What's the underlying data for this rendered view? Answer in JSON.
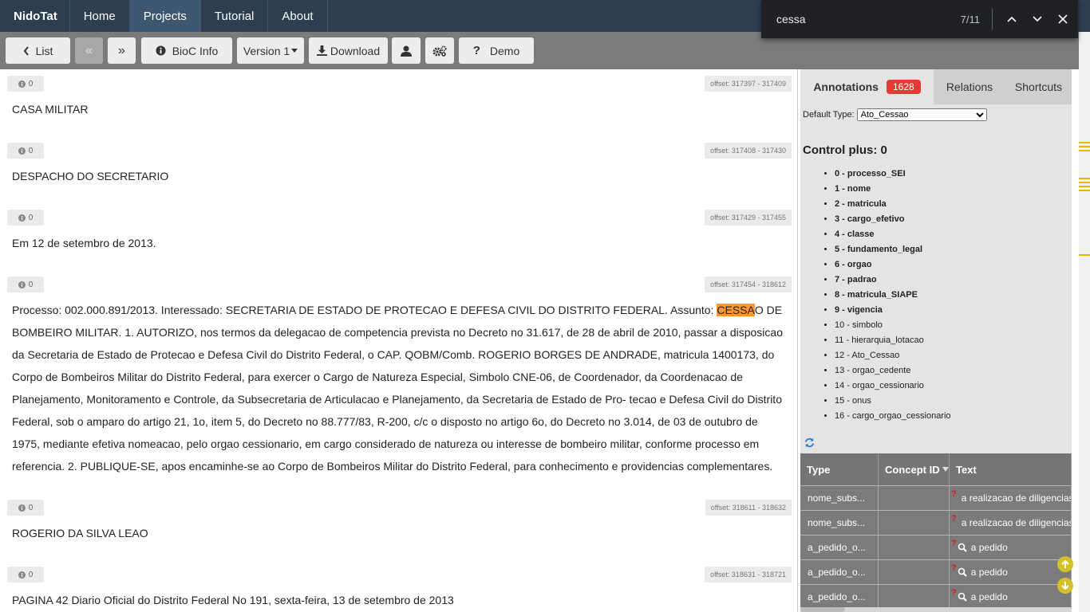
{
  "navbar": {
    "brand": "NidoTat",
    "links": [
      "Home",
      "Projects",
      "Tutorial",
      "About"
    ],
    "active": "Projects"
  },
  "findbar": {
    "query": "cessa",
    "count": "7/11"
  },
  "toolbar": {
    "list": "List",
    "bioc_info": "BioC Info",
    "version": "Version 1",
    "download": "Download",
    "demo": "Demo"
  },
  "passages": [
    {
      "count": "0",
      "offset": "offset: 317397 - 317409",
      "text": "CASA MILITAR"
    },
    {
      "count": "0",
      "offset": "offset: 317408 - 317430",
      "text": "DESPACHO DO SECRETARIO"
    },
    {
      "count": "0",
      "offset": "offset: 317429 - 317455",
      "text": "Em 12 de setembro de 2013."
    },
    {
      "count": "0",
      "offset": "offset: 317454 - 318612",
      "text_before": "Processo: 002.000.891/2013. Interessado: SECRETARIA DE ESTADO DE PROTECAO E DEFESA CIVIL DO DISTRITO FEDERAL. Assunto: ",
      "highlight": "CESSA",
      "text_after": "O DE BOMBEIRO MILITAR. 1. AUTORIZO, nos termos da delegacao de competencia prevista no Decreto no 31.617, de 28 de abril de 2010, passar a disposicao da Secretaria de Estado de Protecao e Defesa Civil do Distrito Federal, o CAP. QOBM/Comb. ROGERIO BORGES DE ANDRADE, matricula 1400173, do Corpo de Bombeiros Militar do Distrito Federal, para exercer o Cargo de Natureza Especial, Simbolo CNE-06, de Coordenador, da Coordenacao de Planejamento, Monitoramento e Controle, da Subsecretaria de Articulacao e Planejamento, da Secretaria de Estado de Pro- tecao e Defesa Civil do Distrito Federal, sob o amparo do artigo 21, 1o, item 5, do Decreto no 88.777/83, R-200, c/c o disposto no artigo 6o, do Decreto no 3.014, de 03 de outubro de 1975, mediante efetiva nomeacao, pelo orgao cessionario, em cargo considerado de natureza ou interesse de bombeiro militar, conforme processo em referencia. 2. PUBLIQUE-SE, apos encaminhe-se ao Corpo de Bombeiros Militar do Distrito Federal, para conhecimento e providencias complementares."
    },
    {
      "count": "0",
      "offset": "offset: 318611 - 318632",
      "text": "ROGERIO DA SILVA LEAO"
    },
    {
      "count": "0",
      "offset": "offset: 318631 - 318721",
      "text": "PAGINA 42 Diario Oficial do Distrito Federal No 191, sexta-feira, 13 de setembro de 2013"
    }
  ],
  "panel": {
    "tabs": {
      "annotations": "Annotations",
      "annotations_count": "1628",
      "relations": "Relations",
      "shortcuts": "Shortcuts"
    },
    "default_type_label": "Default Type:",
    "default_type_value": "Ato_Cessao",
    "control_plus": "Control plus: 0",
    "types": [
      "0 - processo_SEI",
      "1 - nome",
      "2 - matricula",
      "3 - cargo_efetivo",
      "4 - classe",
      "5 - fundamento_legal",
      "6 - orgao",
      "7 - padrao",
      "8 - matricula_SIAPE",
      "9 - vigencia",
      "10 - simbolo",
      "11 - hierarquia_lotacao",
      "12 - Ato_Cessao",
      "13 - orgao_cedente",
      "14 - orgao_cessionario",
      "15 - onus",
      "16 - cargo_orgao_cessionario"
    ],
    "table": {
      "headers": [
        "Type",
        "Concept ID",
        "Text"
      ],
      "rows": [
        {
          "type": "nome_subs...",
          "concept": "",
          "text": "a realizacao de diligencias"
        },
        {
          "type": "nome_subs...",
          "concept": "",
          "text": "a realizacao de diligencias"
        },
        {
          "type": "a_pedido_o...",
          "concept": "",
          "text": "a pedido"
        },
        {
          "type": "a_pedido_o...",
          "concept": "",
          "text": "a pedido"
        },
        {
          "type": "a_pedido_o...",
          "concept": "",
          "text": "a pedido"
        }
      ]
    }
  }
}
